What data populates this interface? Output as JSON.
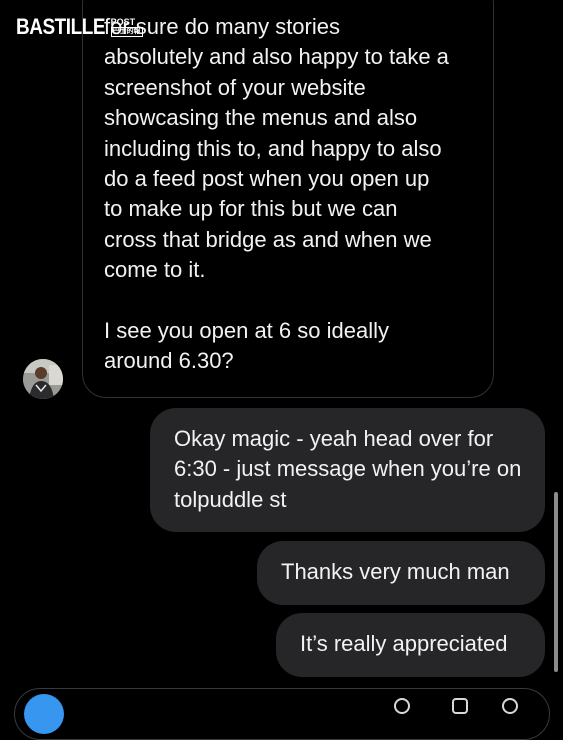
{
  "watermark": {
    "brand": "BASTILLE",
    "brand_small_top": "POST",
    "brand_small_bottom": "巴士的報"
  },
  "incoming_message": {
    "paragraph_1": "for sure do many stories\nabsolutely and also happy to take a\nscreenshot of your website\nshowcasing the menus and also\nincluding this to, and happy to also\ndo a feed post when you open up\nto make up for this but we can\ncross that bridge as and when we\ncome to it.",
    "paragraph_2": "I see you open at 6 so ideally\naround 6.30?"
  },
  "outgoing_messages": [
    {
      "text": "Okay magic - yeah head over for 6:30 - just message when you’re on tolpuddle st"
    },
    {
      "text": "Thanks very much man"
    },
    {
      "text": "It’s really appreciated"
    }
  ],
  "colors": {
    "background": "#000000",
    "outgoing_bubble": "#262629",
    "incoming_border": "#303034",
    "accent": "#3797f0"
  },
  "icons": {
    "avatar": "sender-avatar",
    "camera": "camera-icon",
    "mic": "microphone-icon",
    "gallery": "gallery-icon",
    "sticker": "sticker-icon"
  }
}
